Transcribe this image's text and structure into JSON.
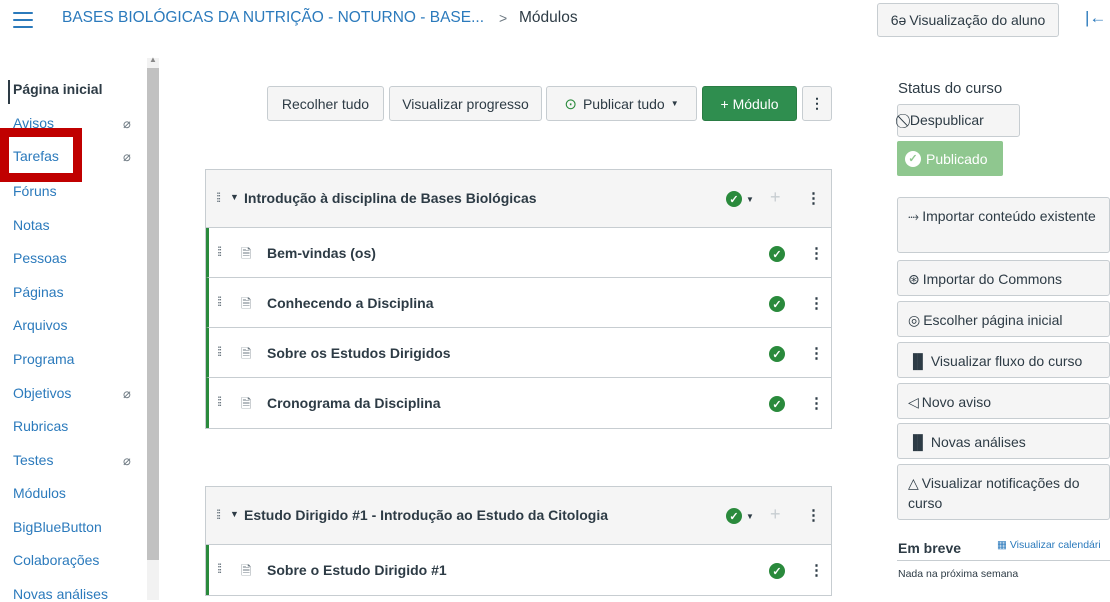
{
  "header": {
    "course": "BASES BIOLÓGICAS DA NUTRIÇÃO - NOTURNO - BASE...",
    "separator": ">",
    "page": "Módulos",
    "student_view_icon": "6ə",
    "student_view": "Visualização do aluno",
    "collapse_icon": "|←"
  },
  "nav": {
    "items": [
      {
        "label": "Página inicial",
        "active": true,
        "hidden": false
      },
      {
        "label": "Avisos",
        "hidden": true
      },
      {
        "label": "Tarefas",
        "hidden": true
      },
      {
        "label": "Fóruns",
        "hidden": false
      },
      {
        "label": "Notas",
        "hidden": false
      },
      {
        "label": "Pessoas",
        "hidden": false
      },
      {
        "label": "Páginas",
        "hidden": false
      },
      {
        "label": "Arquivos",
        "hidden": false
      },
      {
        "label": "Programa",
        "hidden": false
      },
      {
        "label": "Objetivos",
        "hidden": true
      },
      {
        "label": "Rubricas",
        "hidden": false
      },
      {
        "label": "Testes",
        "hidden": true
      },
      {
        "label": "Módulos",
        "hidden": false
      },
      {
        "label": "BigBlueButton",
        "hidden": false
      },
      {
        "label": "Colaborações",
        "hidden": false
      },
      {
        "label": "Novas análises",
        "hidden": false
      }
    ],
    "eye_glyph": "⌀"
  },
  "toolbar": {
    "collapse_all": "Recolher tudo",
    "view_progress": "Visualizar progresso",
    "publish_all_icon": "⊙",
    "publish_all": "Publicar tudo",
    "publish_caret": "▼",
    "add_module": "+ Módulo",
    "more": "⋮"
  },
  "modules": [
    {
      "title": "Introdução à disciplina de Bases Biológicas",
      "items": [
        "Bem-vindas (os)",
        "Conhecendo a Disciplina",
        "Sobre os Estudos Dirigidos",
        "Cronograma da Disciplina"
      ]
    },
    {
      "title": "Estudo Dirigido #1 - Introdução ao Estudo da Citologia",
      "items": [
        "Sobre o Estudo Dirigido #1"
      ]
    }
  ],
  "glyphs": {
    "check": "✓",
    "grip": "⁞⁞",
    "tri": "▼",
    "plus": "+",
    "kebab": "⋮",
    "page": "🗎",
    "caret": "▼"
  },
  "sidebar": {
    "status_title": "Status do curso",
    "unpublish_icon": "⃠",
    "unpublish": "Despublicar",
    "published": "Publicado",
    "buttons": [
      {
        "icon": "⤑",
        "label": "Importar conteúdo existente"
      },
      {
        "icon": "⊛",
        "label": "Importar do Commons"
      },
      {
        "icon": "◎",
        "label": "Escolher página inicial"
      },
      {
        "icon": "▐▌",
        "label": "Visualizar fluxo do curso"
      },
      {
        "icon": "◁",
        "label": "Novo aviso"
      },
      {
        "icon": "▐▌",
        "label": "Novas análises"
      },
      {
        "icon": "△",
        "label": "Visualizar notificações do curso"
      }
    ],
    "soon_title": "Em breve",
    "calendar_icon": "▦",
    "calendar_link": "Visualizar calendári",
    "soon_empty": "Nada na próxima semana"
  },
  "colors": {
    "link": "#2b7abc",
    "publish_green": "#2a8a3c",
    "published_bg": "#8fc78f",
    "highlight": "#c00000"
  }
}
